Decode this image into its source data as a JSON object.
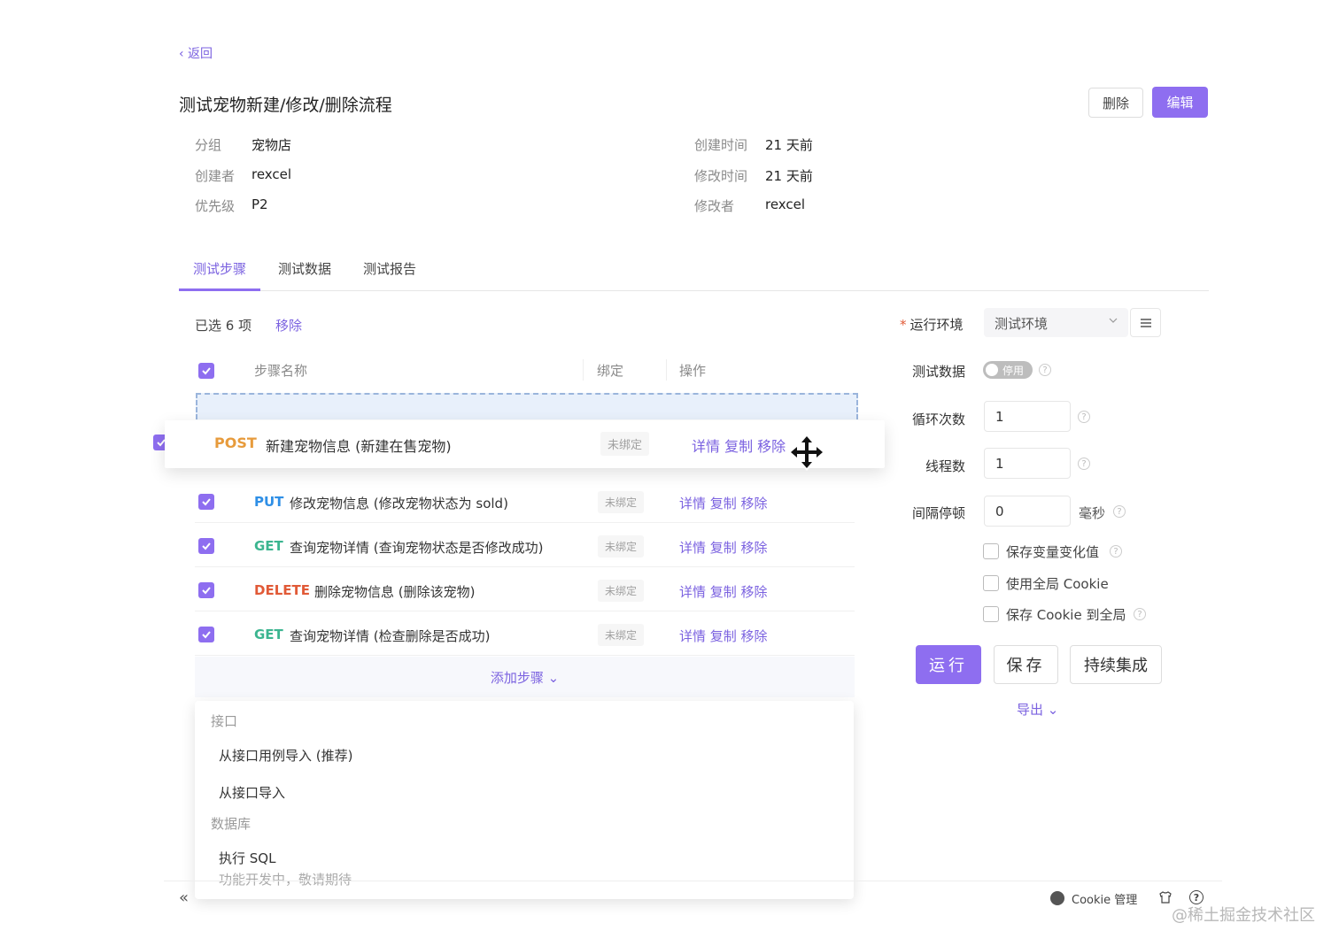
{
  "nav": {
    "back_label": "‹ 返回"
  },
  "header": {
    "title": "测试宠物新建/修改/删除流程",
    "delete_label": "删除",
    "edit_label": "编辑"
  },
  "meta": {
    "left": [
      {
        "label": "分组",
        "value": "宠物店"
      },
      {
        "label": "创建者",
        "value": "rexcel"
      },
      {
        "label": "优先级",
        "value": "P2"
      }
    ],
    "right": [
      {
        "label": "创建时间",
        "value": "21 天前"
      },
      {
        "label": "修改时间",
        "value": "21 天前"
      },
      {
        "label": "修改者",
        "value": "rexcel"
      }
    ]
  },
  "tabs": [
    {
      "label": "测试步骤",
      "active": true
    },
    {
      "label": "测试数据",
      "active": false
    },
    {
      "label": "测试报告",
      "active": false
    }
  ],
  "selection": {
    "count_text": "已选 6 项",
    "remove_label": "移除"
  },
  "table": {
    "headers": {
      "name": "步骤名称",
      "binding": "绑定",
      "actions": "操作"
    }
  },
  "dragged_step": {
    "method": "POST",
    "name": "新建宠物信息 (新建在售宠物)",
    "binding": "未绑定",
    "actions": "详情 复制 移除"
  },
  "steps": [
    {
      "method": "PUT",
      "name": "修改宠物信息 (修改宠物状态为 sold)",
      "binding": "未绑定",
      "actions": "详情 复制 移除"
    },
    {
      "method": "GET",
      "name": "查询宠物详情 (查询宠物状态是否修改成功)",
      "binding": "未绑定",
      "actions": "详情 复制 移除"
    },
    {
      "method": "DELETE",
      "name": "删除宠物信息 (删除该宠物)",
      "binding": "未绑定",
      "actions": "详情 复制 移除"
    },
    {
      "method": "GET",
      "name": "查询宠物详情 (检查删除是否成功)",
      "binding": "未绑定",
      "actions": "详情 复制 移除"
    }
  ],
  "add_step": {
    "label": "添加步骤 ⌄"
  },
  "dropdown": {
    "group_api": "接口",
    "item_from_case": "从接口用例导入 (推荐)",
    "item_from_api": "从接口导入",
    "group_db": "数据库",
    "item_sql": "执行 SQL",
    "item_sql_note": "功能开发中，敬请期待"
  },
  "settings": {
    "env_required_mark": "*",
    "env_label": "运行环境",
    "env_value": "测试环境",
    "test_data_label": "测试数据",
    "test_data_toggle": "停用",
    "loop_label": "循环次数",
    "loop_value": "1",
    "threads_label": "线程数",
    "threads_value": "1",
    "interval_label": "间隔停顿",
    "interval_value": "0",
    "interval_unit": "毫秒",
    "opt_save_vars": "保存变量变化值",
    "opt_global_cookie": "使用全局 Cookie",
    "opt_save_cookie": "保存 Cookie 到全局",
    "run_label": "运行",
    "save_label": "保存",
    "ci_label": "持续集成",
    "export_label": "导出 ⌄"
  },
  "footer": {
    "collapse_label": "«",
    "cookie_label": "Cookie 管理",
    "help_label": "?"
  },
  "watermark": "@稀土掘金技术社区",
  "colors": {
    "accent": "#8e6ef0",
    "post": "#e79b3c",
    "put": "#2f8fe6",
    "get": "#3cb590",
    "delete": "#e15a37"
  }
}
